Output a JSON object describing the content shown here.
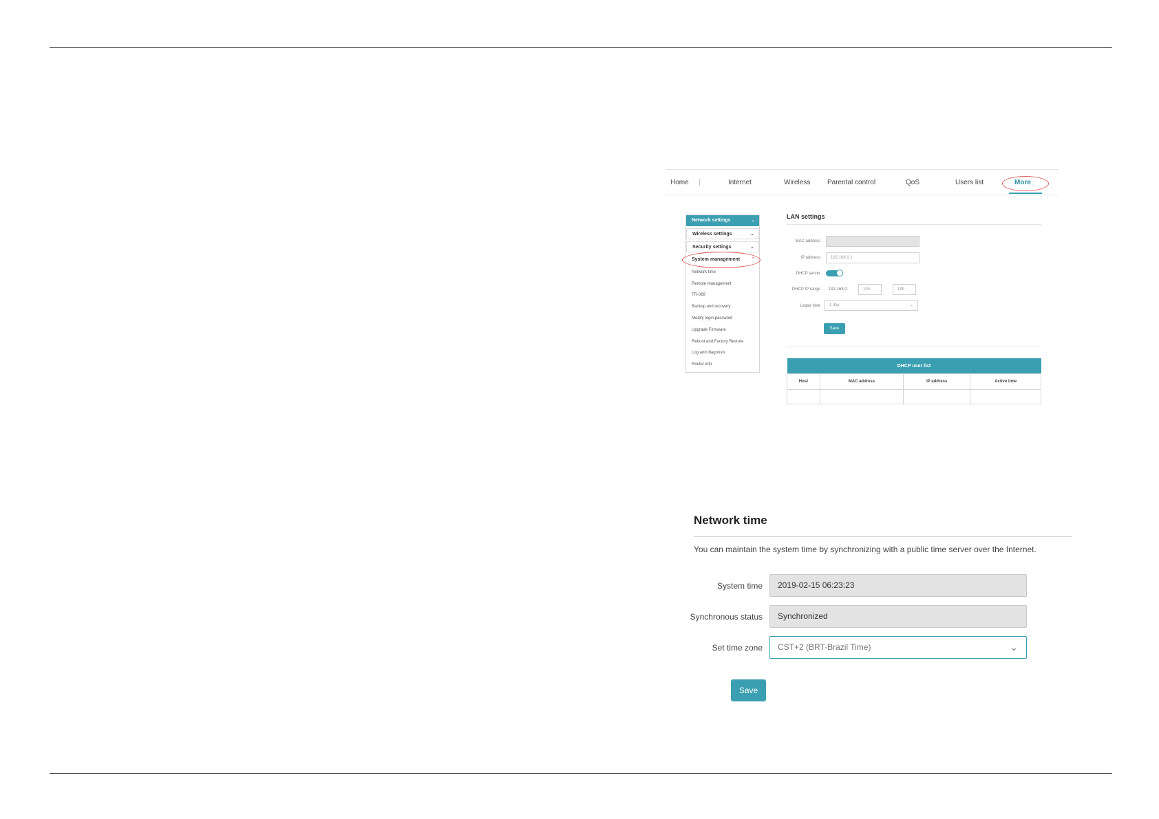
{
  "top_nav": {
    "items": [
      "Home",
      "Internet",
      "Wireless",
      "Parental control",
      "QoS",
      "Users list",
      "More"
    ],
    "separator": "|"
  },
  "side_menu": {
    "network_settings": "Network settings",
    "wireless_settings": "Wireless settings",
    "security_settings": "Security settings",
    "system_management": "System management",
    "sub_items": [
      "Network time",
      "Remote management",
      "TR-069",
      "Backup and recovery",
      "Modify login password",
      "Upgrade Firmware",
      "Reboot and Factory Restore",
      "Log and diagnosis",
      "Router info"
    ]
  },
  "lan": {
    "title": "LAN settings",
    "mac_label": "MAC address",
    "ip_label": "IP address",
    "ip_value": "192.168.0.1",
    "dhcp_server_label": "DHCP server",
    "dhcp_range_label": "DHCP IP range",
    "dhcp_range_prefix": "192.168.0.",
    "dhcp_range_start": "100",
    "dhcp_range_end": "199",
    "lease_label": "Lease time",
    "lease_value": "1 day",
    "save_label": "Save"
  },
  "dhcp_table": {
    "caption": "DHCP user list",
    "columns": [
      "Host",
      "MAC address",
      "IP address",
      "Active time"
    ]
  },
  "network_time": {
    "title": "Network time",
    "description": "You can maintain the system time by synchronizing with a public time server over the Internet.",
    "system_time_label": "System time",
    "system_time_value": "2019-02-15 06:23:23",
    "sync_status_label": "Synchronous status",
    "sync_status_value": "Synchronized",
    "time_zone_label": "Set time zone",
    "time_zone_value": "CST+2 (BRT-Brazil Time)",
    "save_label": "Save"
  },
  "icons": {
    "dropdown": "chevron-down-icon",
    "collapse": "chevron-up-icon"
  },
  "colors": {
    "accent": "#3a9fb0",
    "highlight_circle": "#e05b5b"
  }
}
